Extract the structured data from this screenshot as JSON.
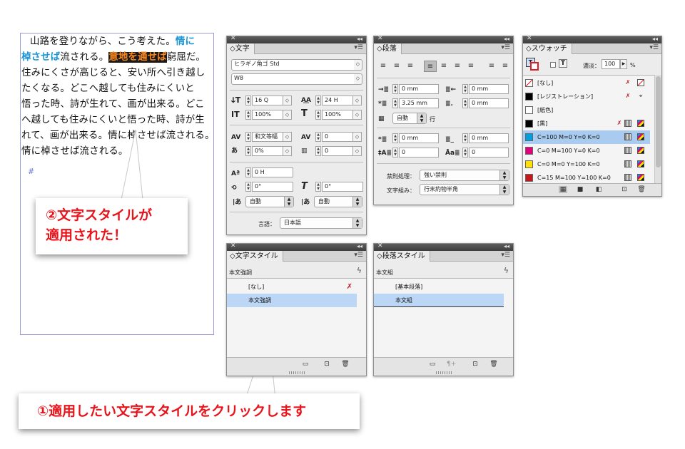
{
  "document": {
    "lines": [
      {
        "parts": [
          {
            "t": "山路を登りながら、こう考えた。",
            "s": ""
          },
          {
            "t": "情に",
            "s": "blue"
          }
        ]
      },
      {
        "parts": [
          {
            "t": "棹させば",
            "s": "blue"
          },
          {
            "t": "流される。",
            "s": ""
          },
          {
            "t": "意地を通せば",
            "s": "hl"
          },
          {
            "t": "窮屈だ。",
            "s": ""
          }
        ]
      },
      {
        "parts": [
          {
            "t": "住みにくさが高じると、安い所へ引き越し",
            "s": ""
          }
        ]
      },
      {
        "parts": [
          {
            "t": "たくなる。どこへ越しても住みにくいと",
            "s": ""
          }
        ]
      },
      {
        "parts": [
          {
            "t": "悟った時、詩が生れて、画が出来る。どこ",
            "s": ""
          }
        ]
      },
      {
        "parts": [
          {
            "t": "へ越しても住みにくいと悟った時、詩が生",
            "s": ""
          }
        ]
      },
      {
        "parts": [
          {
            "t": "れて、画が出来る。情に棹させば流される。",
            "s": ""
          }
        ]
      },
      {
        "parts": [
          {
            "t": "情に棹させば流される。",
            "s": ""
          }
        ]
      }
    ],
    "end_mark": "#"
  },
  "callouts": {
    "top": "②文字スタイルが\n適用された！",
    "bottom": "①適用したい文字スタイルをクリックします"
  },
  "character_panel": {
    "tab": "◇文字",
    "font_family": "ヒラギノ角ゴ Std",
    "font_style": "W8",
    "font_size": "16 Q",
    "leading": "24 H",
    "vertical_scale": "100%",
    "horizontal_scale": "100%",
    "kerning": "和文等幅",
    "tracking": "0",
    "tsume": "0%",
    "aki": "0",
    "baseline_shift": "0 H",
    "rotation": "0°",
    "skew": "0°",
    "mojisoroe_1": "自動",
    "mojisoroe_2": "自動",
    "language_label": "言語：",
    "language": "日本語"
  },
  "paragraph_panel": {
    "tab": "◇段落",
    "left_indent": "0 mm",
    "right_indent": "0 mm",
    "first_line_indent": "3.25 mm",
    "last_line_indent": "0 mm",
    "grid_lines": "自動",
    "grid_lines_unit": "行",
    "space_before": "0 mm",
    "space_after": "0 mm",
    "drop_cap_lines": "0",
    "drop_cap_chars": "0",
    "kinsoku_label": "禁則処理：",
    "kinsoku": "強い禁則",
    "mojikumi_label": "文字組み：",
    "mojikumi": "行末約物半角"
  },
  "swatches_panel": {
    "tab": "◇スウォッチ",
    "tint_label": "濃淡：",
    "tint": "100",
    "tint_unit": "%",
    "swatches": [
      {
        "name": "[なし]",
        "color": "none"
      },
      {
        "name": "[レジストレーション]",
        "color": "#000000"
      },
      {
        "name": "[紙色]",
        "color": "#ffffff"
      },
      {
        "name": "[黒]",
        "color": "#000000"
      },
      {
        "name": "C=100 M=0 Y=0 K=0",
        "color": "#00a0e0"
      },
      {
        "name": "C=0 M=100 Y=0 K=0",
        "color": "#e0007a"
      },
      {
        "name": "C=0 M=0 Y=100 K=0",
        "color": "#ffe000"
      },
      {
        "name": "C=15 M=100 Y=100 K=0",
        "color": "#c8161d"
      }
    ],
    "selected_index": 4
  },
  "char_style_panel": {
    "tab": "◇文字スタイル",
    "current": "本文強調",
    "items": [
      "[なし]",
      "本文強調"
    ],
    "selected_index": 1
  },
  "para_style_panel": {
    "tab": "◇段落スタイル",
    "current": "本文組",
    "items": [
      "[基本段落]",
      "本文組"
    ],
    "selected_index": 1
  },
  "colors": {
    "callout_text": "#e8141b",
    "highlight_bg": "#1a1a1a",
    "highlight_text": "#ff8a1c",
    "blue_text": "#1a96d8",
    "selection": "#bcd7f5"
  }
}
